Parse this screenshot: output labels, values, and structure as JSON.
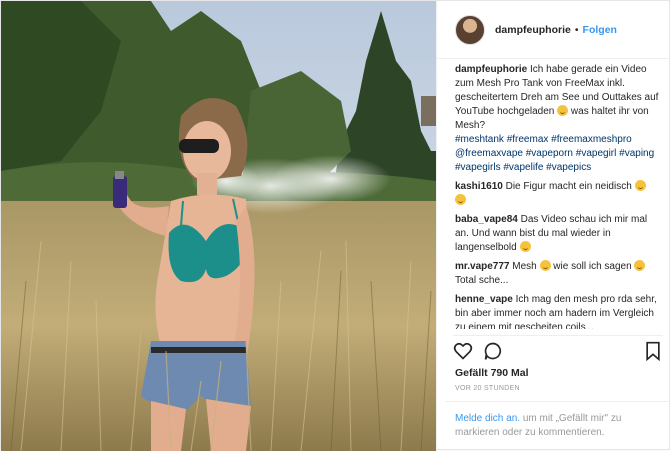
{
  "post": {
    "username": "dampfeuphorie",
    "follow_label": "Folgen",
    "separator": "•",
    "caption": {
      "user": "dampfeuphorie",
      "text_before_emoji": "Ich habe gerade ein Video zum Mesh Pro Tank von FreeMax inkl. gescheitertem Dreh am See und Outtakes auf YouTube hochgeladen",
      "text_after_emoji": "was haltet ihr von Mesh?",
      "hashtags": "#meshtank #freemax #freemaxmeshpro @freemaxvape #vapeporn #vapegirl #vaping #vapegirls #vapelife #vapepics"
    },
    "comments": [
      {
        "user": "kashi1610",
        "text": "Die Figur macht ein neidisch",
        "emoji_after": true,
        "emoji2": true
      },
      {
        "user": "baba_vape84",
        "text": "Das Video schau ich mir mal an. Und wann bist du mal wieder in langenselbold",
        "emoji_after": true
      },
      {
        "user": "mr.vape777",
        "text_before": "Mesh",
        "text_middle": "wie soll ich sagen",
        "text_after": "Total sche..."
      },
      {
        "user": "henne_vape",
        "text": "Ich mag den mesh pro rda sehr, bin aber immer noch am hadern im Vergleich zu einem mit gescheiten coils..."
      }
    ],
    "likes": "Gefällt 790 Mal",
    "timestamp": "VOR 20 STUNDEN",
    "login_prompt": {
      "link": "Melde dich an.",
      "rest": "um mit „Gefällt mir\" zu markieren oder zu kommentieren."
    },
    "icons": {
      "like": "heart-icon",
      "comment": "comment-icon",
      "save": "bookmark-icon"
    },
    "colors": {
      "link": "#3897f0",
      "hashtag": "#003569",
      "text": "#262626",
      "muted": "#999999"
    }
  }
}
